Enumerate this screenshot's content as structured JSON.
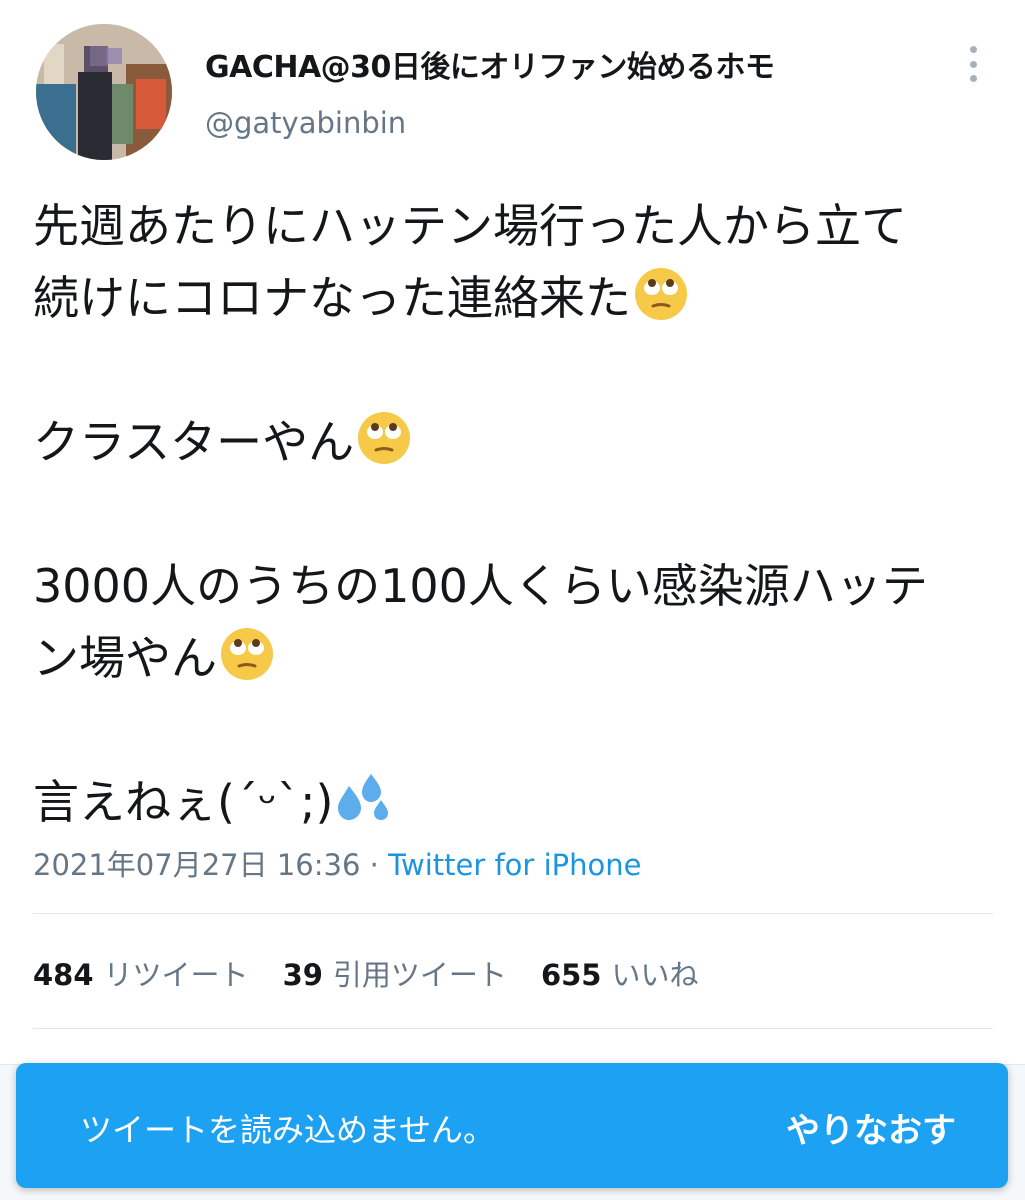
{
  "user": {
    "display_name": "GACHA@30日後にオリファン始めるホモ",
    "handle": "@gatyabinbin",
    "avatar_icon": "profile-photo"
  },
  "menu_icon": "more-vertical-icon",
  "tweet": {
    "lines": [
      "先週あたりにハッテン場行った人から立て",
      "続けにコロナなった連絡来た",
      "クラスターやん",
      "3000人のうちの100人くらい感染源ハッテ",
      "ン場やん",
      "言えねぇ(´ᵕ`;)"
    ],
    "emojis": [
      "face-with-rolling-eyes",
      "face-with-rolling-eyes",
      "face-with-rolling-eyes",
      "sweat-droplets"
    ]
  },
  "meta": {
    "timestamp": "2021年07月27日 16:36",
    "separator": " · ",
    "source": "Twitter for iPhone"
  },
  "stats": {
    "retweets": {
      "count": "484",
      "label": "リツイート"
    },
    "quotes": {
      "count": "39",
      "label": "引用ツイート"
    },
    "likes": {
      "count": "655",
      "label": "いいね"
    }
  },
  "toast": {
    "message": "ツイートを読み込めません。",
    "retry_label": "やりなおす",
    "background": "#1da1f2"
  }
}
